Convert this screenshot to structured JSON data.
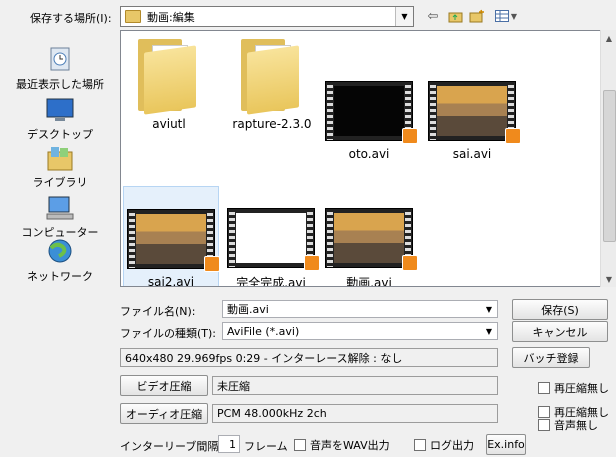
{
  "save_in": {
    "label": "保存する場所(I):",
    "location": "動画:編集"
  },
  "toolbar_icons": [
    "back-arrow-icon",
    "up-folder-icon",
    "new-folder-icon",
    "view-menu-icon"
  ],
  "places": [
    {
      "label": "最近表示した場所",
      "icon": "recent-places-icon"
    },
    {
      "label": "デスクトップ",
      "icon": "desktop-icon"
    },
    {
      "label": "ライブラリ",
      "icon": "libraries-icon"
    },
    {
      "label": "コンピューター",
      "icon": "computer-icon"
    },
    {
      "label": "ネットワーク",
      "icon": "network-icon"
    }
  ],
  "files": [
    {
      "name": "aviutl",
      "type": "folder"
    },
    {
      "name": "rapture-2.3.0",
      "type": "folder"
    },
    {
      "name": "oto.avi",
      "type": "video-black"
    },
    {
      "name": "sai.avi",
      "type": "video-scene"
    },
    {
      "name": "sai2.avi",
      "type": "video-scene",
      "selected": true
    },
    {
      "name": "完全完成.avi",
      "type": "video-white"
    },
    {
      "name": "動画.avi",
      "type": "video-scene"
    }
  ],
  "filename": {
    "label": "ファイル名(N):",
    "value": "動画.avi"
  },
  "filetype": {
    "label": "ファイルの種類(T):",
    "value": "AviFile (*.avi)"
  },
  "buttons": {
    "save": "保存(S)",
    "cancel": "キャンセル",
    "batch": "バッチ登録",
    "video_compress": "ビデオ圧縮",
    "audio_compress": "オーディオ圧縮",
    "exinfo": "Ex.info"
  },
  "info_line": "640x480  29.969fps  0:29  -  インターレース解除 : なし",
  "video_codec": "未圧縮",
  "audio_codec": "PCM 48.000kHz 2ch",
  "checkboxes": {
    "recompress_video": "再圧縮無し",
    "recompress_audio": "再圧縮無し",
    "no_audio": "音声無し",
    "wav_out": "音声をWAV出力",
    "log_out": "ログ出力"
  },
  "interleave": {
    "label": "インターリーブ間隔 :",
    "value": "1",
    "unit": "フレーム"
  }
}
